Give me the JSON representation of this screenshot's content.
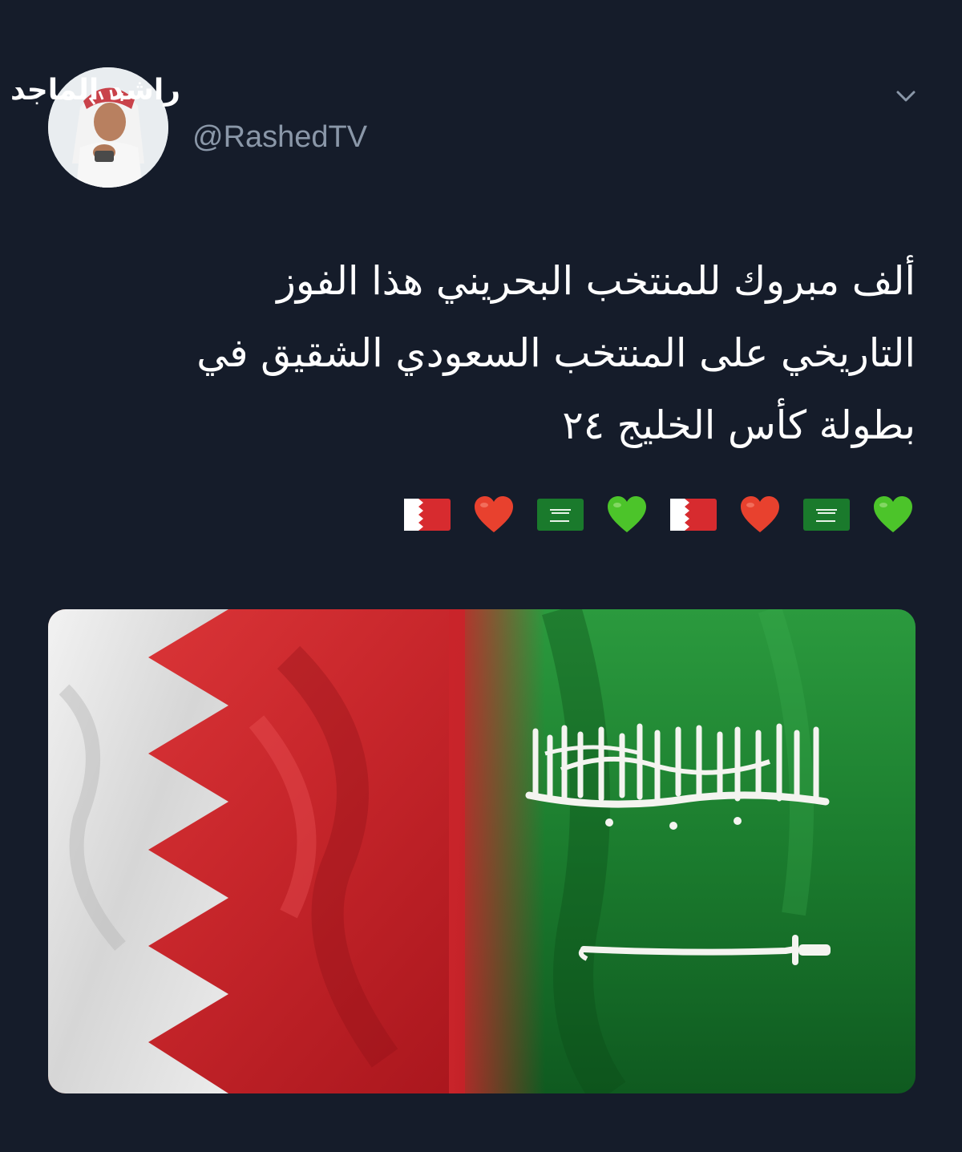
{
  "tweet": {
    "author": {
      "display_name": "راشد الماجد",
      "handle": "@RashedTV",
      "verified": true
    },
    "text_lines": [
      "ألف مبروك للمنتخب البحريني هذا الفوز",
      "التاريخي على المنتخب السعودي الشقيق في",
      "بطولة كأس الخليج ٢٤"
    ],
    "emoji_sequence": [
      "flag-bahrain",
      "red-heart",
      "flag-saudi-arabia",
      "green-heart",
      "flag-bahrain",
      "red-heart",
      "flag-saudi-arabia",
      "green-heart"
    ],
    "media": {
      "saudi_inscription": "لا إله إلا الله محمد رسول الله"
    }
  },
  "colors": {
    "background": "#151c2a",
    "handle_gray": "#8a97a8",
    "bahrain_red": "#d72b2f",
    "saudi_green": "#1a7a2c",
    "red_heart": "#e8412e",
    "green_heart": "#4cc42a"
  },
  "icons": {
    "menu_caret": "chevron-down-icon",
    "verified_badge": "verified-badge-icon"
  }
}
